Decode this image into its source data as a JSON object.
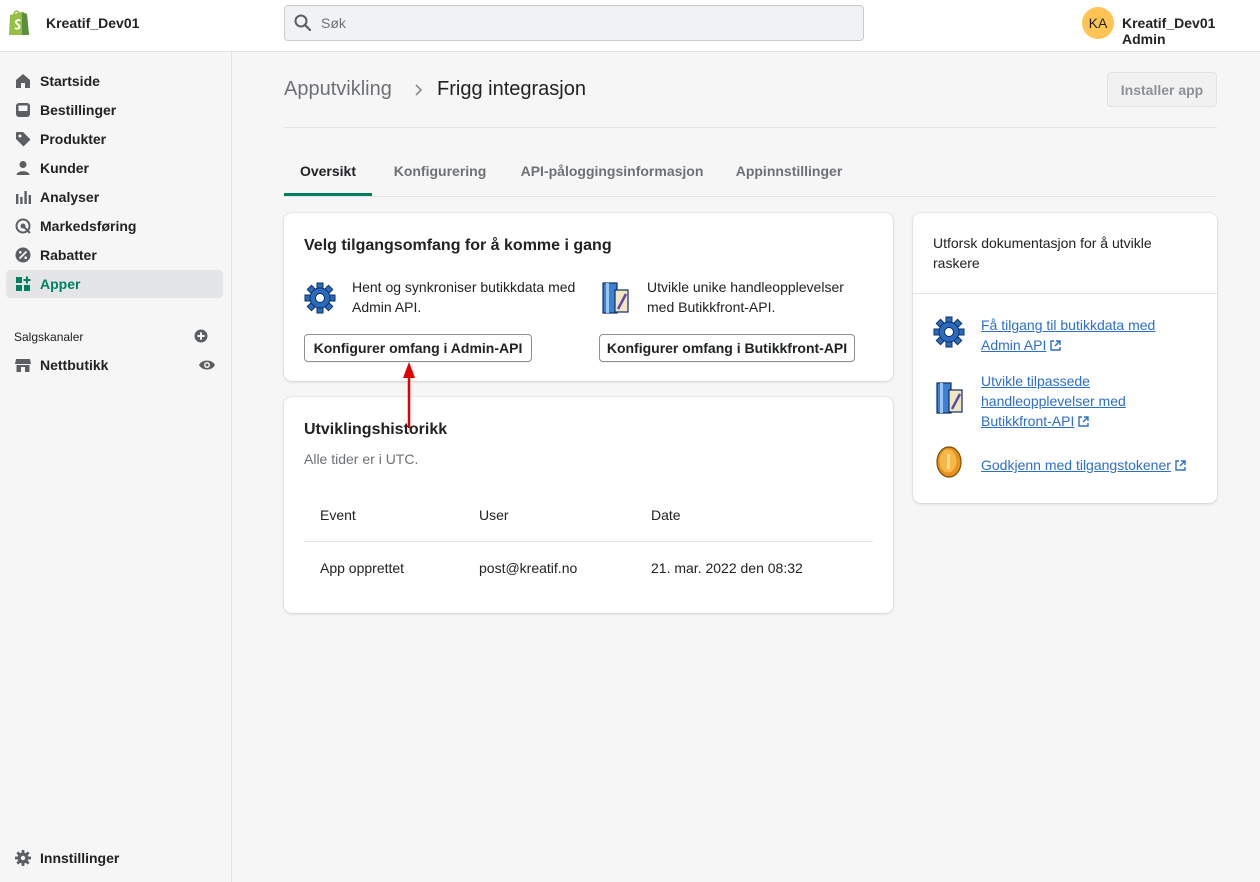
{
  "topbar": {
    "store_name": "Kreatif_Dev01",
    "search_placeholder": "Søk",
    "avatar_initials": "KA",
    "admin_name": "Kreatif_Dev01 Admin"
  },
  "sidebar": {
    "items": [
      {
        "label": "Startside",
        "icon": "home-icon"
      },
      {
        "label": "Bestillinger",
        "icon": "orders-icon"
      },
      {
        "label": "Produkter",
        "icon": "tag-icon"
      },
      {
        "label": "Kunder",
        "icon": "person-icon"
      },
      {
        "label": "Analyser",
        "icon": "analytics-icon"
      },
      {
        "label": "Markedsføring",
        "icon": "target-icon"
      },
      {
        "label": "Rabatter",
        "icon": "discount-icon"
      },
      {
        "label": "Apper",
        "icon": "apps-icon",
        "active": true
      }
    ],
    "sales_channels_label": "Salgskanaler",
    "channels": [
      {
        "label": "Nettbutikk",
        "icon": "store-icon"
      }
    ],
    "settings_label": "Innstillinger"
  },
  "header": {
    "breadcrumb_parent": "Apputvikling",
    "title": "Frigg integrasjon",
    "install_label": "Installer app"
  },
  "tabs": [
    {
      "label": "Oversikt",
      "active": true
    },
    {
      "label": "Konfigurering"
    },
    {
      "label": "API-påloggingsinformasjon"
    },
    {
      "label": "Appinnstillinger"
    }
  ],
  "scope_card": {
    "title": "Velg tilgangsomfang for å komme i gang",
    "admin_desc_1": "Hent og synkroniser butikkdata med",
    "admin_desc_2": "Admin API.",
    "admin_button": "Konfigurer omfang i Admin-API",
    "storefront_desc_1": "Utvikle unike handleopplevelser",
    "storefront_desc_2": "med Butikkfront-API.",
    "storefront_button": "Konfigurer omfang i Butikkfront-API"
  },
  "history_card": {
    "title": "Utviklingshistorikk",
    "subtitle": "Alle tider er i UTC.",
    "columns": [
      "Event",
      "User",
      "Date"
    ],
    "rows": [
      {
        "event": "App opprettet",
        "user": "post@kreatif.no",
        "date": "21. mar. 2022 den 08:32"
      }
    ]
  },
  "docs_card": {
    "intro_1": "Utforsk dokumentasjon for å utvikle",
    "intro_2": "raskere",
    "links": [
      {
        "lines": [
          "Få tilgang til butikkdata med",
          "Admin API"
        ],
        "icon": "gear-icon"
      },
      {
        "lines": [
          "Utvikle tilpassede",
          "handleopplevelser med",
          "Butikkfront-API"
        ],
        "icon": "storefront-icon"
      },
      {
        "lines": [
          "Godkjenn med tilgangstokener"
        ],
        "icon": "coin-icon"
      }
    ]
  },
  "colors": {
    "accent": "#008060",
    "link": "#2c6ecb",
    "annotation_arrow": "#e00000",
    "avatar": "#ffc453"
  }
}
